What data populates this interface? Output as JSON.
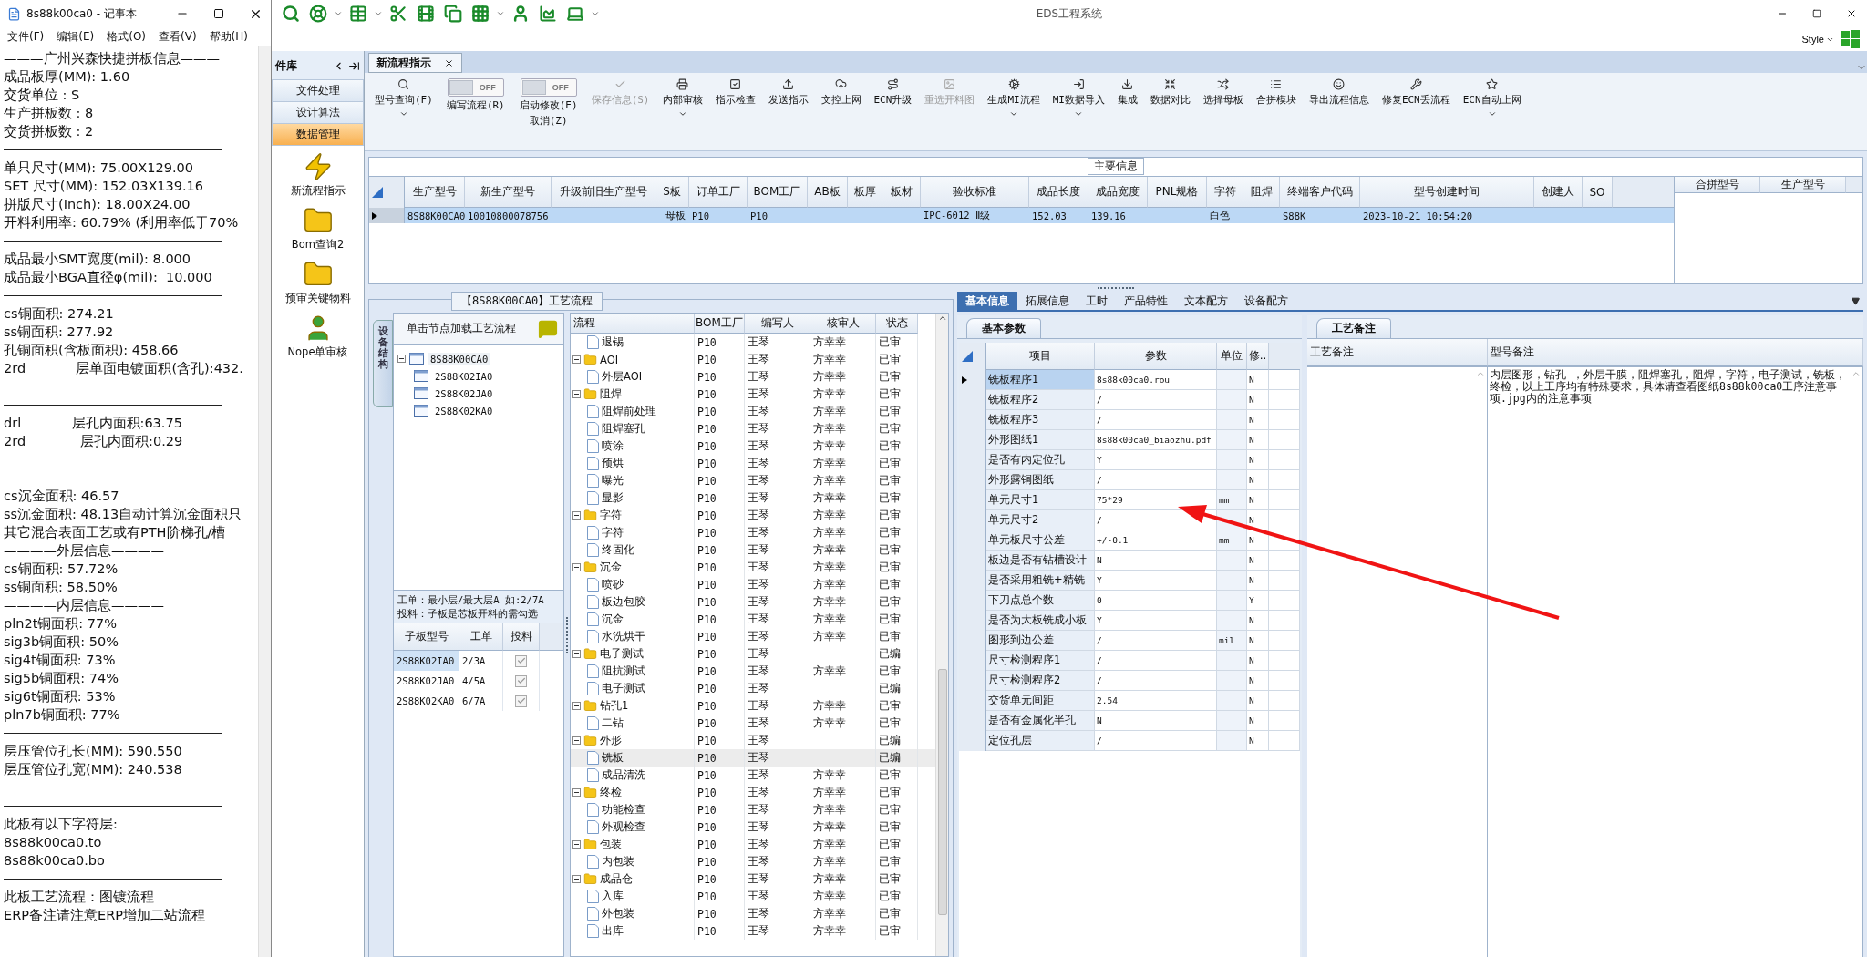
{
  "notepad": {
    "title": "8s88k00ca0 - 记事本",
    "menu": [
      "文件(F)",
      "编辑(E)",
      "格式(O)",
      "查看(V)",
      "帮助(H)"
    ],
    "lines": [
      {
        "kind": "text",
        "text": "———广州兴森快捷拼板信息———"
      },
      {
        "kind": "text",
        "text": "成品板厚(MM): 1.60"
      },
      {
        "kind": "text",
        "text": "交货单位 : S"
      },
      {
        "kind": "text",
        "text": "生产拼板数 : 8"
      },
      {
        "kind": "text",
        "text": "交货拼板数 : 2"
      },
      {
        "kind": "rule"
      },
      {
        "kind": "text",
        "text": "单只尺寸(MM): 75.00X129.00"
      },
      {
        "kind": "text",
        "text": "SET 尺寸(MM): 152.03X139.16"
      },
      {
        "kind": "text",
        "text": "拼版尺寸(Inch): 18.00X24.00"
      },
      {
        "kind": "text",
        "text": "开料利用率: 60.79% (利用率低于70%"
      },
      {
        "kind": "rule"
      },
      {
        "kind": "text",
        "text": "成品最小SMT宽度(mil): 8.000"
      },
      {
        "kind": "text",
        "text": "成品最小BGA直径φ(mil):  10.000"
      },
      {
        "kind": "rule"
      },
      {
        "kind": "text",
        "text": "cs铜面积: 274.21"
      },
      {
        "kind": "text",
        "text": "ss铜面积: 277.92"
      },
      {
        "kind": "text",
        "text": "孔铜面积(含板面积): 458.66"
      },
      {
        "kind": "text",
        "text": "2rd            层单面电镀面积(含孔):432."
      },
      {
        "kind": "blank"
      },
      {
        "kind": "rule"
      },
      {
        "kind": "text",
        "text": "drl            层孔内面积:63.75"
      },
      {
        "kind": "text",
        "text": "2rd             层孔内面积:0.29"
      },
      {
        "kind": "blank"
      },
      {
        "kind": "rule"
      },
      {
        "kind": "text",
        "text": "cs沉金面积: 46.57"
      },
      {
        "kind": "text",
        "text": "ss沉金面积: 48.13自动计算沉金面积只"
      },
      {
        "kind": "text",
        "text": "其它混合表面工艺或有PTH阶梯孔/槽"
      },
      {
        "kind": "text",
        "text": "————外层信息————"
      },
      {
        "kind": "text",
        "text": "cs铜面积: 57.72%"
      },
      {
        "kind": "text",
        "text": "ss铜面积: 58.50%"
      },
      {
        "kind": "text",
        "text": "————内层信息————"
      },
      {
        "kind": "text",
        "text": "pln2t铜面积: 77%"
      },
      {
        "kind": "text",
        "text": "sig3b铜面积: 50%"
      },
      {
        "kind": "text",
        "text": "sig4t铜面积: 73%"
      },
      {
        "kind": "text",
        "text": "sig5b铜面积: 74%"
      },
      {
        "kind": "text",
        "text": "sig6t铜面积: 53%"
      },
      {
        "kind": "text",
        "text": "pln7b铜面积: 77%"
      },
      {
        "kind": "rule"
      },
      {
        "kind": "text",
        "text": "层压管位孔长(MM): 590.550"
      },
      {
        "kind": "text",
        "text": "层压管位孔宽(MM): 240.538"
      },
      {
        "kind": "blank"
      },
      {
        "kind": "rule"
      },
      {
        "kind": "text",
        "text": "此板有以下字符层:"
      },
      {
        "kind": "text",
        "text": "8s88k00ca0.to"
      },
      {
        "kind": "text",
        "text": "8s88k00ca0.bo"
      },
      {
        "kind": "rule"
      },
      {
        "kind": "text",
        "text": "此板工艺流程：图镀流程"
      },
      {
        "kind": "text",
        "text": "ERP备注请注意ERP增加二站流程"
      }
    ]
  },
  "app": {
    "title": "EDS工程系统",
    "style_menu": "Style"
  },
  "sidebar": {
    "header": "件库",
    "categories": [
      {
        "label": "文件处理",
        "selected": false
      },
      {
        "label": "设计算法",
        "selected": false
      },
      {
        "label": "数据管理",
        "selected": true
      }
    ],
    "tools": [
      {
        "label": "新流程指示"
      },
      {
        "label": "Bom查询2"
      },
      {
        "label": "预审关键物料"
      },
      {
        "label": "Nope单审核"
      }
    ]
  },
  "tabs": [
    {
      "label": "新流程指示",
      "selected": true
    }
  ],
  "ribbon": [
    {
      "kind": "button",
      "label": "型号查询(F)",
      "disabled": false,
      "has_menu": true
    },
    {
      "kind": "toggle",
      "label": "编写流程(R)",
      "on": false,
      "state_label": "OFF"
    },
    {
      "kind": "toggle",
      "label": "启动修改(E)",
      "label2": "取消(Z)",
      "on": false,
      "state_label": "OFF"
    },
    {
      "kind": "button",
      "label": "保存信息(S)",
      "disabled": true,
      "has_menu": false
    },
    {
      "kind": "button",
      "label": "内部审核",
      "disabled": false,
      "has_menu": true
    },
    {
      "kind": "button",
      "label": "指示检查",
      "disabled": false,
      "has_menu": false
    },
    {
      "kind": "button",
      "label": "发送指示",
      "disabled": false,
      "has_menu": false
    },
    {
      "kind": "button",
      "label": "文控上网",
      "disabled": false,
      "has_menu": false
    },
    {
      "kind": "button",
      "label": "ECN升级",
      "disabled": false,
      "has_menu": false
    },
    {
      "kind": "button",
      "label": "重选开料图",
      "disabled": true,
      "has_menu": false
    },
    {
      "kind": "button",
      "label": "生成MI流程",
      "disabled": false,
      "has_menu": true
    },
    {
      "kind": "button",
      "label": "MI数据导入",
      "disabled": false,
      "has_menu": true
    },
    {
      "kind": "button",
      "label": "集成",
      "disabled": false,
      "has_menu": false
    },
    {
      "kind": "button",
      "label": "数据对比",
      "disabled": false,
      "has_menu": false
    },
    {
      "kind": "button",
      "label": "选择母板",
      "disabled": false,
      "has_menu": false
    },
    {
      "kind": "button",
      "label": "合拼模块",
      "disabled": false,
      "has_menu": false
    },
    {
      "kind": "button",
      "label": "导出流程信息",
      "disabled": false,
      "has_menu": false
    },
    {
      "kind": "button",
      "label": "修复ECN丢流程",
      "disabled": false,
      "has_menu": false
    },
    {
      "kind": "button",
      "label": "ECN自动上网",
      "disabled": false,
      "has_menu": true
    }
  ],
  "main_info": {
    "title": "主要信息",
    "columns": [
      "生产型号",
      "新生产型号",
      "升级前旧生产型号",
      "S板",
      "订单工厂",
      "BOM工厂",
      "AB板",
      "板厚",
      "板材",
      "验收标准",
      "成品长度",
      "成品宽度",
      "PNL规格",
      "字符",
      "阻焊",
      "终端客户代码",
      "型号创建时间",
      "创建人",
      "SO"
    ],
    "rows": [
      {
        "selected": true,
        "cells": [
          "8S88K00CA0",
          "10010800078756",
          null,
          "母板",
          "P10",
          "P10",
          null,
          null,
          null,
          "IPC-6012 Ⅱ级",
          "152.03",
          "139.16",
          null,
          "白色",
          null,
          "S88K",
          "2023-10-21 10:54:20",
          null,
          null
        ]
      }
    ],
    "side_columns": [
      "合拼型号",
      "生产型号"
    ]
  },
  "process": {
    "title": "【8S88K00CA0】工艺流程",
    "side_tab": "设备结构",
    "hint": "单击节点加载工艺流程",
    "tree": [
      {
        "label": "8S88K00CA0",
        "selected": true,
        "expanded": true,
        "children": [
          {
            "label": "2S88K02IA0",
            "selected": false
          },
          {
            "label": "2S88K02JA0",
            "selected": false
          },
          {
            "label": "2S88K02KA0",
            "selected": false
          }
        ]
      }
    ],
    "notes": [
      "工单：最小层/最大层A 如:2/7A",
      "投料：子板是芯板开料的需勾选"
    ],
    "sub_columns": [
      "子板型号",
      "工单",
      "投料"
    ],
    "sub_rows": [
      {
        "board": "2S88K02IA0",
        "order": "2/3A",
        "checked": true,
        "selected": true
      },
      {
        "board": "2S88K02JA0",
        "order": "4/5A",
        "checked": true,
        "selected": false
      },
      {
        "board": "2S88K02KA0",
        "order": "6/7A",
        "checked": true,
        "selected": false
      }
    ],
    "flow_columns": [
      "流程",
      "BOM工厂",
      "编写人",
      "核审人",
      "状态"
    ],
    "flow": [
      {
        "children": [
          {
            "label": "退锡",
            "bom": "P10",
            "writer": "王琴",
            "reviewer": "方幸幸",
            "status": "已审",
            "selected": false
          }
        ]
      },
      {
        "label": "AOI",
        "bom": "P10",
        "writer": "王琴",
        "reviewer": "方幸幸",
        "status": "已审",
        "selected": false,
        "expanded": true,
        "children": [
          {
            "label": "外层AOI",
            "bom": "P10",
            "writer": "王琴",
            "reviewer": "方幸幸",
            "status": "已审",
            "selected": false
          }
        ]
      },
      {
        "label": "阻焊",
        "bom": "P10",
        "writer": "王琴",
        "reviewer": "方幸幸",
        "status": "已审",
        "selected": false,
        "expanded": true,
        "children": [
          {
            "label": "阻焊前处理",
            "bom": "P10",
            "writer": "王琴",
            "reviewer": "方幸幸",
            "status": "已审",
            "selected": false
          },
          {
            "label": "阻焊塞孔",
            "bom": "P10",
            "writer": "王琴",
            "reviewer": "方幸幸",
            "status": "已审",
            "selected": false
          },
          {
            "label": "喷涂",
            "bom": "P10",
            "writer": "王琴",
            "reviewer": "方幸幸",
            "status": "已审",
            "selected": false
          },
          {
            "label": "预烘",
            "bom": "P10",
            "writer": "王琴",
            "reviewer": "方幸幸",
            "status": "已审",
            "selected": false
          },
          {
            "label": "曝光",
            "bom": "P10",
            "writer": "王琴",
            "reviewer": "方幸幸",
            "status": "已审",
            "selected": false
          },
          {
            "label": "显影",
            "bom": "P10",
            "writer": "王琴",
            "reviewer": "方幸幸",
            "status": "已审",
            "selected": false
          }
        ]
      },
      {
        "label": "字符",
        "bom": "P10",
        "writer": "王琴",
        "reviewer": "方幸幸",
        "status": "已审",
        "selected": false,
        "expanded": true,
        "children": [
          {
            "label": "字符",
            "bom": "P10",
            "writer": "王琴",
            "reviewer": "方幸幸",
            "status": "已审",
            "selected": false
          },
          {
            "label": "终固化",
            "bom": "P10",
            "writer": "王琴",
            "reviewer": "方幸幸",
            "status": "已审",
            "selected": false
          }
        ]
      },
      {
        "label": "沉金",
        "bom": "P10",
        "writer": "王琴",
        "reviewer": "方幸幸",
        "status": "已审",
        "selected": false,
        "expanded": true,
        "children": [
          {
            "label": "喷砂",
            "bom": "P10",
            "writer": "王琴",
            "reviewer": "方幸幸",
            "status": "已审",
            "selected": false
          },
          {
            "label": "板边包胶",
            "bom": "P10",
            "writer": "王琴",
            "reviewer": "方幸幸",
            "status": "已审",
            "selected": false
          },
          {
            "label": "沉金",
            "bom": "P10",
            "writer": "王琴",
            "reviewer": "方幸幸",
            "status": "已审",
            "selected": false
          },
          {
            "label": "水洗烘干",
            "bom": "P10",
            "writer": "王琴",
            "reviewer": "方幸幸",
            "status": "已审",
            "selected": false
          }
        ]
      },
      {
        "label": "电子测试",
        "bom": "P10",
        "writer": "王琴",
        "status": "已编",
        "selected": false,
        "expanded": true,
        "children": [
          {
            "label": "阻抗测试",
            "bom": "P10",
            "writer": "王琴",
            "reviewer": "方幸幸",
            "status": "已审",
            "selected": false
          },
          {
            "label": "电子测试",
            "bom": "P10",
            "writer": "王琴",
            "status": "已编",
            "selected": false
          }
        ]
      },
      {
        "label": "钻孔1",
        "bom": "P10",
        "writer": "王琴",
        "reviewer": "方幸幸",
        "status": "已审",
        "selected": false,
        "expanded": true,
        "children": [
          {
            "label": "二钻",
            "bom": "P10",
            "writer": "王琴",
            "reviewer": "方幸幸",
            "status": "已审",
            "selected": false
          }
        ]
      },
      {
        "label": "外形",
        "bom": "P10",
        "writer": "王琴",
        "status": "已编",
        "selected": false,
        "expanded": true,
        "children": [
          {
            "label": "铣板",
            "bom": "P10",
            "writer": "王琴",
            "status": "已编",
            "selected": true
          },
          {
            "label": "成品清洗",
            "bom": "P10",
            "writer": "王琴",
            "reviewer": "方幸幸",
            "status": "已审",
            "selected": false
          }
        ]
      },
      {
        "label": "终检",
        "bom": "P10",
        "writer": "王琴",
        "reviewer": "方幸幸",
        "status": "已审",
        "selected": false,
        "expanded": true,
        "children": [
          {
            "label": "功能检查",
            "bom": "P10",
            "writer": "王琴",
            "reviewer": "方幸幸",
            "status": "已审",
            "selected": false
          },
          {
            "label": "外观检查",
            "bom": "P10",
            "writer": "王琴",
            "reviewer": "方幸幸",
            "status": "已审",
            "selected": false
          }
        ]
      },
      {
        "label": "包装",
        "bom": "P10",
        "writer": "王琴",
        "reviewer": "方幸幸",
        "status": "已审",
        "selected": false,
        "expanded": true,
        "children": [
          {
            "label": "内包装",
            "bom": "P10",
            "writer": "王琴",
            "reviewer": "方幸幸",
            "status": "已审",
            "selected": false
          }
        ]
      },
      {
        "label": "成品仓",
        "bom": "P10",
        "writer": "王琴",
        "reviewer": "方幸幸",
        "status": "已审",
        "selected": false,
        "expanded": true,
        "children": [
          {
            "label": "入库",
            "bom": "P10",
            "writer": "王琴",
            "reviewer": "方幸幸",
            "status": "已审",
            "selected": false
          },
          {
            "label": "外包装",
            "bom": "P10",
            "writer": "王琴",
            "reviewer": "方幸幸",
            "status": "已审",
            "selected": false
          },
          {
            "label": "出库",
            "bom": "P10",
            "writer": "王琴",
            "reviewer": "方幸幸",
            "status": "已审",
            "selected": false
          }
        ]
      }
    ]
  },
  "detail": {
    "tabs": [
      {
        "label": "基本信息",
        "selected": true
      },
      {
        "label": "拓展信息",
        "selected": false
      },
      {
        "label": "工时",
        "selected": false
      },
      {
        "label": "产品特性",
        "selected": false
      },
      {
        "label": "文本配方",
        "selected": false
      },
      {
        "label": "设备配方",
        "selected": false
      }
    ],
    "param_tab": "基本参数",
    "param_columns": [
      "项目",
      "参数",
      "单位",
      "修.."
    ],
    "params": [
      {
        "item": "铣板程序1",
        "value": "8s88k00ca0.rou",
        "flag": "N",
        "selected": true
      },
      {
        "item": "铣板程序2",
        "value": "/",
        "flag": "N",
        "selected": false
      },
      {
        "item": "铣板程序3",
        "value": "/",
        "flag": "N",
        "selected": false
      },
      {
        "item": "外形图纸1",
        "value": "8s88k00ca0_biaozhu.pdf",
        "flag": "N",
        "selected": false
      },
      {
        "item": "是否有内定位孔",
        "value": "Y",
        "flag": "N",
        "selected": false
      },
      {
        "item": "外形露铜图纸",
        "value": "/",
        "flag": "N",
        "selected": false
      },
      {
        "item": "单元尺寸1",
        "value": "75*29",
        "unit": "mm",
        "flag": "N",
        "selected": false
      },
      {
        "item": "单元尺寸2",
        "value": "/",
        "flag": "N",
        "selected": false
      },
      {
        "item": "单元板尺寸公差",
        "value": "+/-0.1",
        "unit": "mm",
        "flag": "N",
        "selected": false
      },
      {
        "item": "板边是否有钻槽设计",
        "value": "N",
        "flag": "N",
        "selected": false
      },
      {
        "item": "是否采用粗铣+精铣",
        "value": "Y",
        "flag": "N",
        "selected": false
      },
      {
        "item": "下刀点总个数",
        "value": "0",
        "flag": "Y",
        "selected": false
      },
      {
        "item": "是否为大板铣成小板",
        "value": "Y",
        "flag": "N",
        "selected": false
      },
      {
        "item": "图形到边公差",
        "value": "/",
        "unit": "mil",
        "flag": "N",
        "selected": false
      },
      {
        "item": "尺寸检测程序1",
        "value": "/",
        "flag": "N",
        "selected": false
      },
      {
        "item": "尺寸检测程序2",
        "value": "/",
        "flag": "N",
        "selected": false
      },
      {
        "item": "交货单元间距",
        "value": "2.54",
        "flag": "N",
        "selected": false
      },
      {
        "item": "是否有金属化半孔",
        "value": "N",
        "flag": "N",
        "selected": false
      },
      {
        "item": "定位孔层",
        "value": "/",
        "flag": "N",
        "selected": false
      }
    ],
    "remark_tab": "工艺备注",
    "remark_columns": [
      "工艺备注",
      "型号备注"
    ],
    "remark_text": "内层图形，钻孔 ，外层干膜，阻焊塞孔，阻焊，字符，电子测试，铣板，终检，以上工序均有特殊要求，具体请查看图纸8s88k00ca0工序注意事项.jpg内的注意事项"
  }
}
